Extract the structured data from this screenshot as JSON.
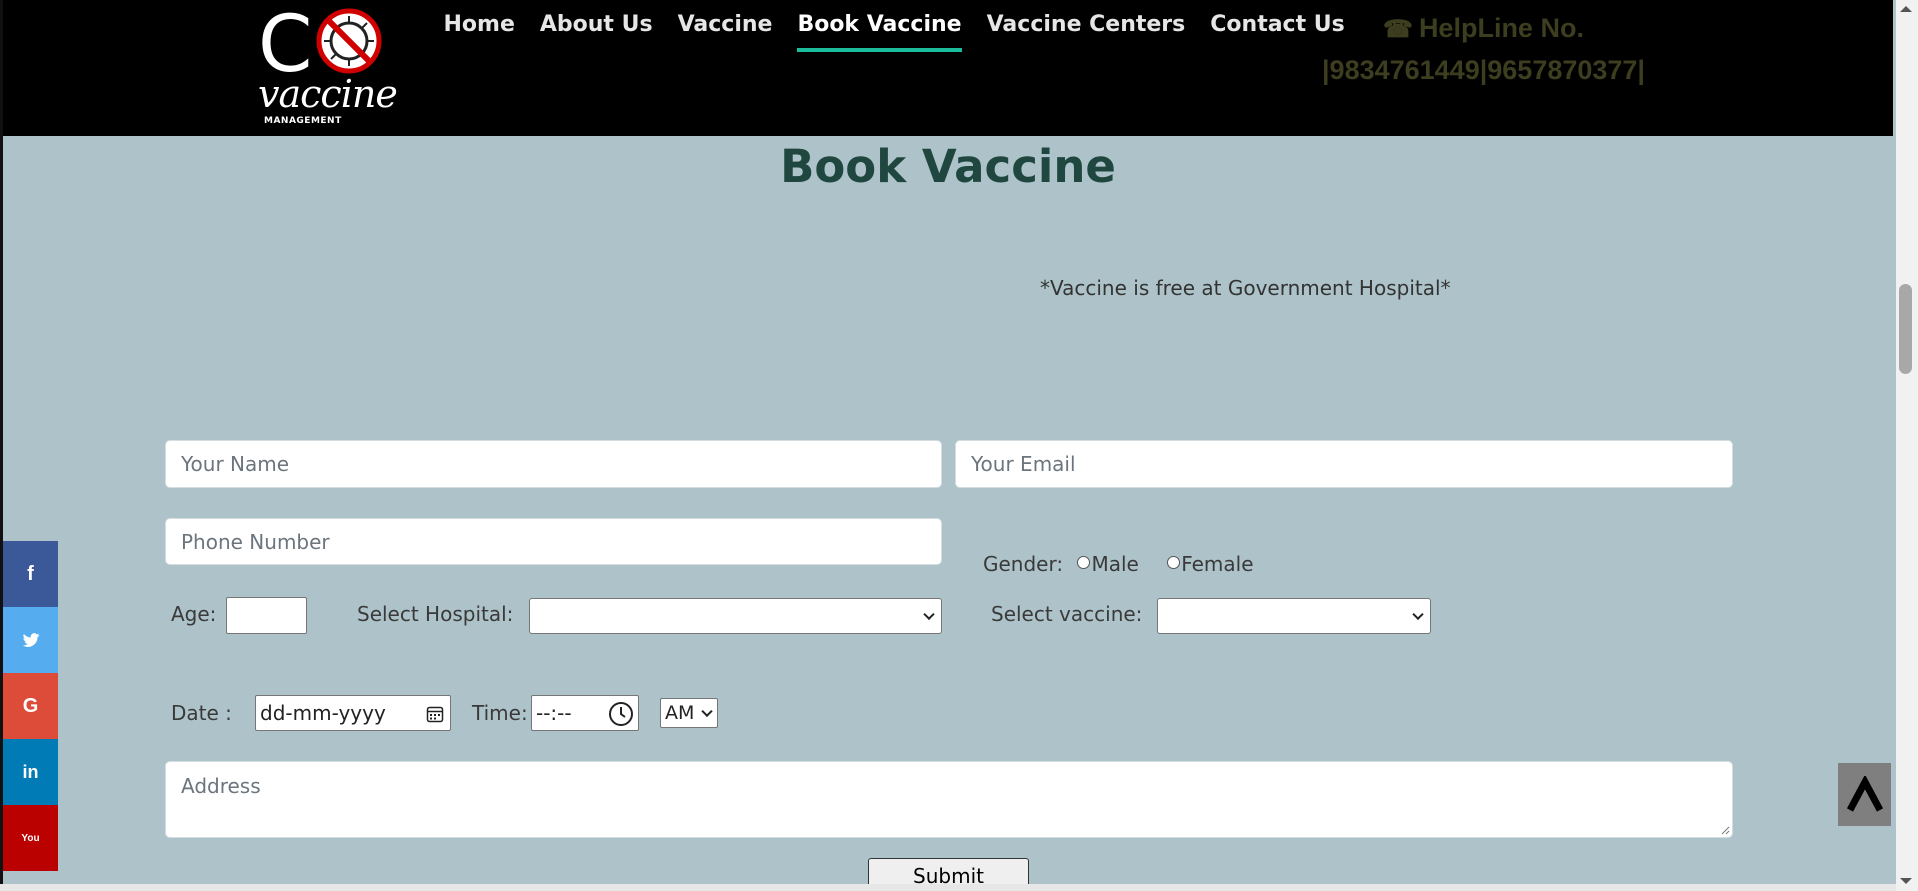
{
  "header": {
    "logo": {
      "letter": "C",
      "word": "vaccine",
      "sub": "MANAGEMENT"
    },
    "nav": [
      {
        "label": "Home",
        "active": false
      },
      {
        "label": "About Us",
        "active": false
      },
      {
        "label": "Vaccine",
        "active": false
      },
      {
        "label": "Book Vaccine",
        "active": true
      },
      {
        "label": "Vaccine Centers",
        "active": false
      },
      {
        "label": "Contact Us",
        "active": false
      }
    ],
    "helpline": {
      "title": "HelpLine No.",
      "numbers": "|9834761449|9657870377|",
      "icon": "phone-icon"
    }
  },
  "main": {
    "title": "Book Vaccine",
    "notice": "*Vaccine is free at Government Hospital*"
  },
  "form": {
    "name_placeholder": "Your Name",
    "email_placeholder": "Your Email",
    "phone_placeholder": "Phone Number",
    "gender_label": "Gender:",
    "gender_options": [
      "Male",
      "Female"
    ],
    "age_label": "Age:",
    "age_value": "",
    "hospital_label": "Select Hospital:",
    "hospital_value": "",
    "vaccine_label": "Select vaccine:",
    "vaccine_value": "",
    "date_label": "Date :",
    "date_value": "dd-mm-yyyy",
    "time_label": "Time:",
    "time_value": "--:--",
    "ampm_value": "AM",
    "address_placeholder": "Address",
    "submit_label": "Submit"
  },
  "social": [
    {
      "name": "facebook",
      "glyph": "f",
      "color": "#3b5998"
    },
    {
      "name": "twitter",
      "glyph": "t",
      "color": "#55acee"
    },
    {
      "name": "google",
      "glyph": "G",
      "color": "#dd4b39"
    },
    {
      "name": "linkedin",
      "glyph": "in",
      "color": "#007bb5"
    },
    {
      "name": "youtube",
      "glyph": "You",
      "color": "#bb0000"
    }
  ],
  "colors": {
    "header_bg": "#000000",
    "page_bg": "#adc3c9",
    "title": "#1f4740",
    "nav_active_underline": "#1abc9c",
    "helpline": "#3d3d1f"
  }
}
